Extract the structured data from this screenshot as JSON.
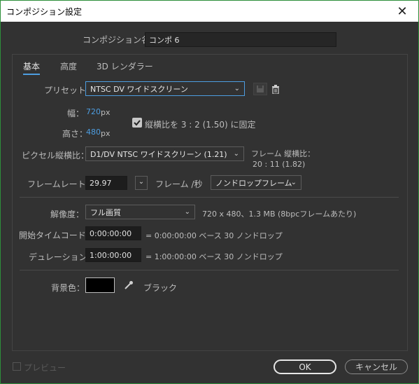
{
  "window": {
    "title": "コンポジション設定"
  },
  "comp_name": {
    "label": "コンポジション名：",
    "value": "コンポ 6"
  },
  "tabs": [
    {
      "label": "基本"
    },
    {
      "label": "高度"
    },
    {
      "label": "3D レンダラー"
    }
  ],
  "preset": {
    "label": "プリセット：",
    "value": "NTSC DV ワイドスクリーン"
  },
  "width": {
    "label": "幅：",
    "value": "720",
    "unit": "px"
  },
  "height": {
    "label": "高さ：",
    "value": "480",
    "unit": "px"
  },
  "lock_aspect": {
    "checked": true,
    "label": "縦横比を 3 : 2 (1.50) に固定"
  },
  "pixel_aspect": {
    "label": "ピクセル縦横比：",
    "value": "D1/DV NTSC ワイドスクリーン (1.21)",
    "frame_aspect_label": "フレーム 縦横比：",
    "frame_aspect_value": "20 : 11 (1.82)"
  },
  "frame_rate": {
    "label": "フレームレート：",
    "value": "29.97",
    "unit": "フレーム /秒",
    "mode": "ノンドロップフレーム"
  },
  "resolution": {
    "label": "解像度：",
    "value": "フル画質",
    "info": "720 x 480、1.3 MB (8bpcフレームあたり)"
  },
  "start_timecode": {
    "label": "開始タイムコード：",
    "value": "0:00:00:00",
    "info": "= 0:00:00:00  ベース 30  ノンドロップ"
  },
  "duration": {
    "label": "デュレーション：",
    "value": "1:00:00:00",
    "info": "= 1:00:00:00  ベース 30  ノンドロップ"
  },
  "background": {
    "label": "背景色：",
    "color": "#000000",
    "name": "ブラック"
  },
  "footer": {
    "preview_label": "プレビュー",
    "ok_label": "OK",
    "cancel_label": "キャンセル"
  },
  "colors": {
    "accent": "#4d9de0",
    "window_border": "#2d8f3a"
  }
}
